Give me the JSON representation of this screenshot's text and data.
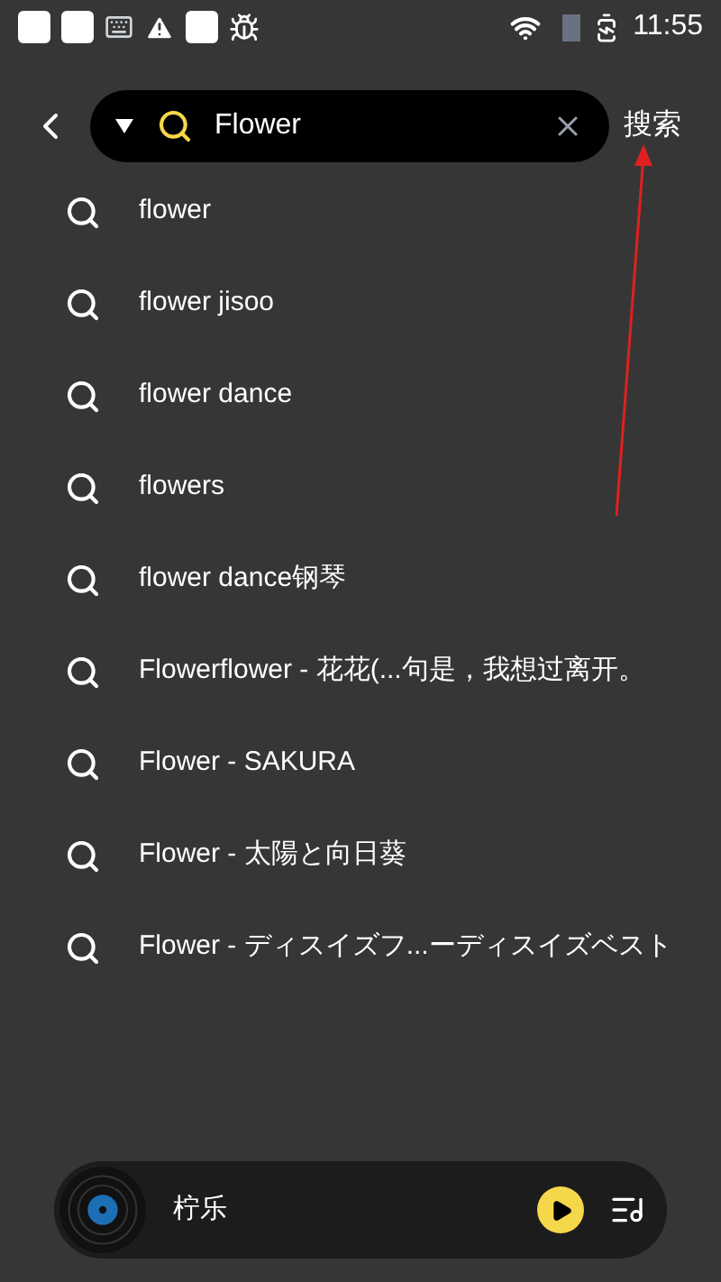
{
  "status_bar": {
    "time": "11:55"
  },
  "search": {
    "value": "Flower",
    "action": "搜索"
  },
  "suggestions": [
    "flower",
    "flower jisoo",
    "flower dance",
    "flowers",
    "flower dance钢琴",
    "Flowerflower - 花花(...句是，我想过离开。",
    "Flower - SAKURA",
    "Flower - 太陽と向日葵",
    "Flower - ディスイズフ...ーディスイズベスト"
  ],
  "player": {
    "title": "柠乐"
  }
}
